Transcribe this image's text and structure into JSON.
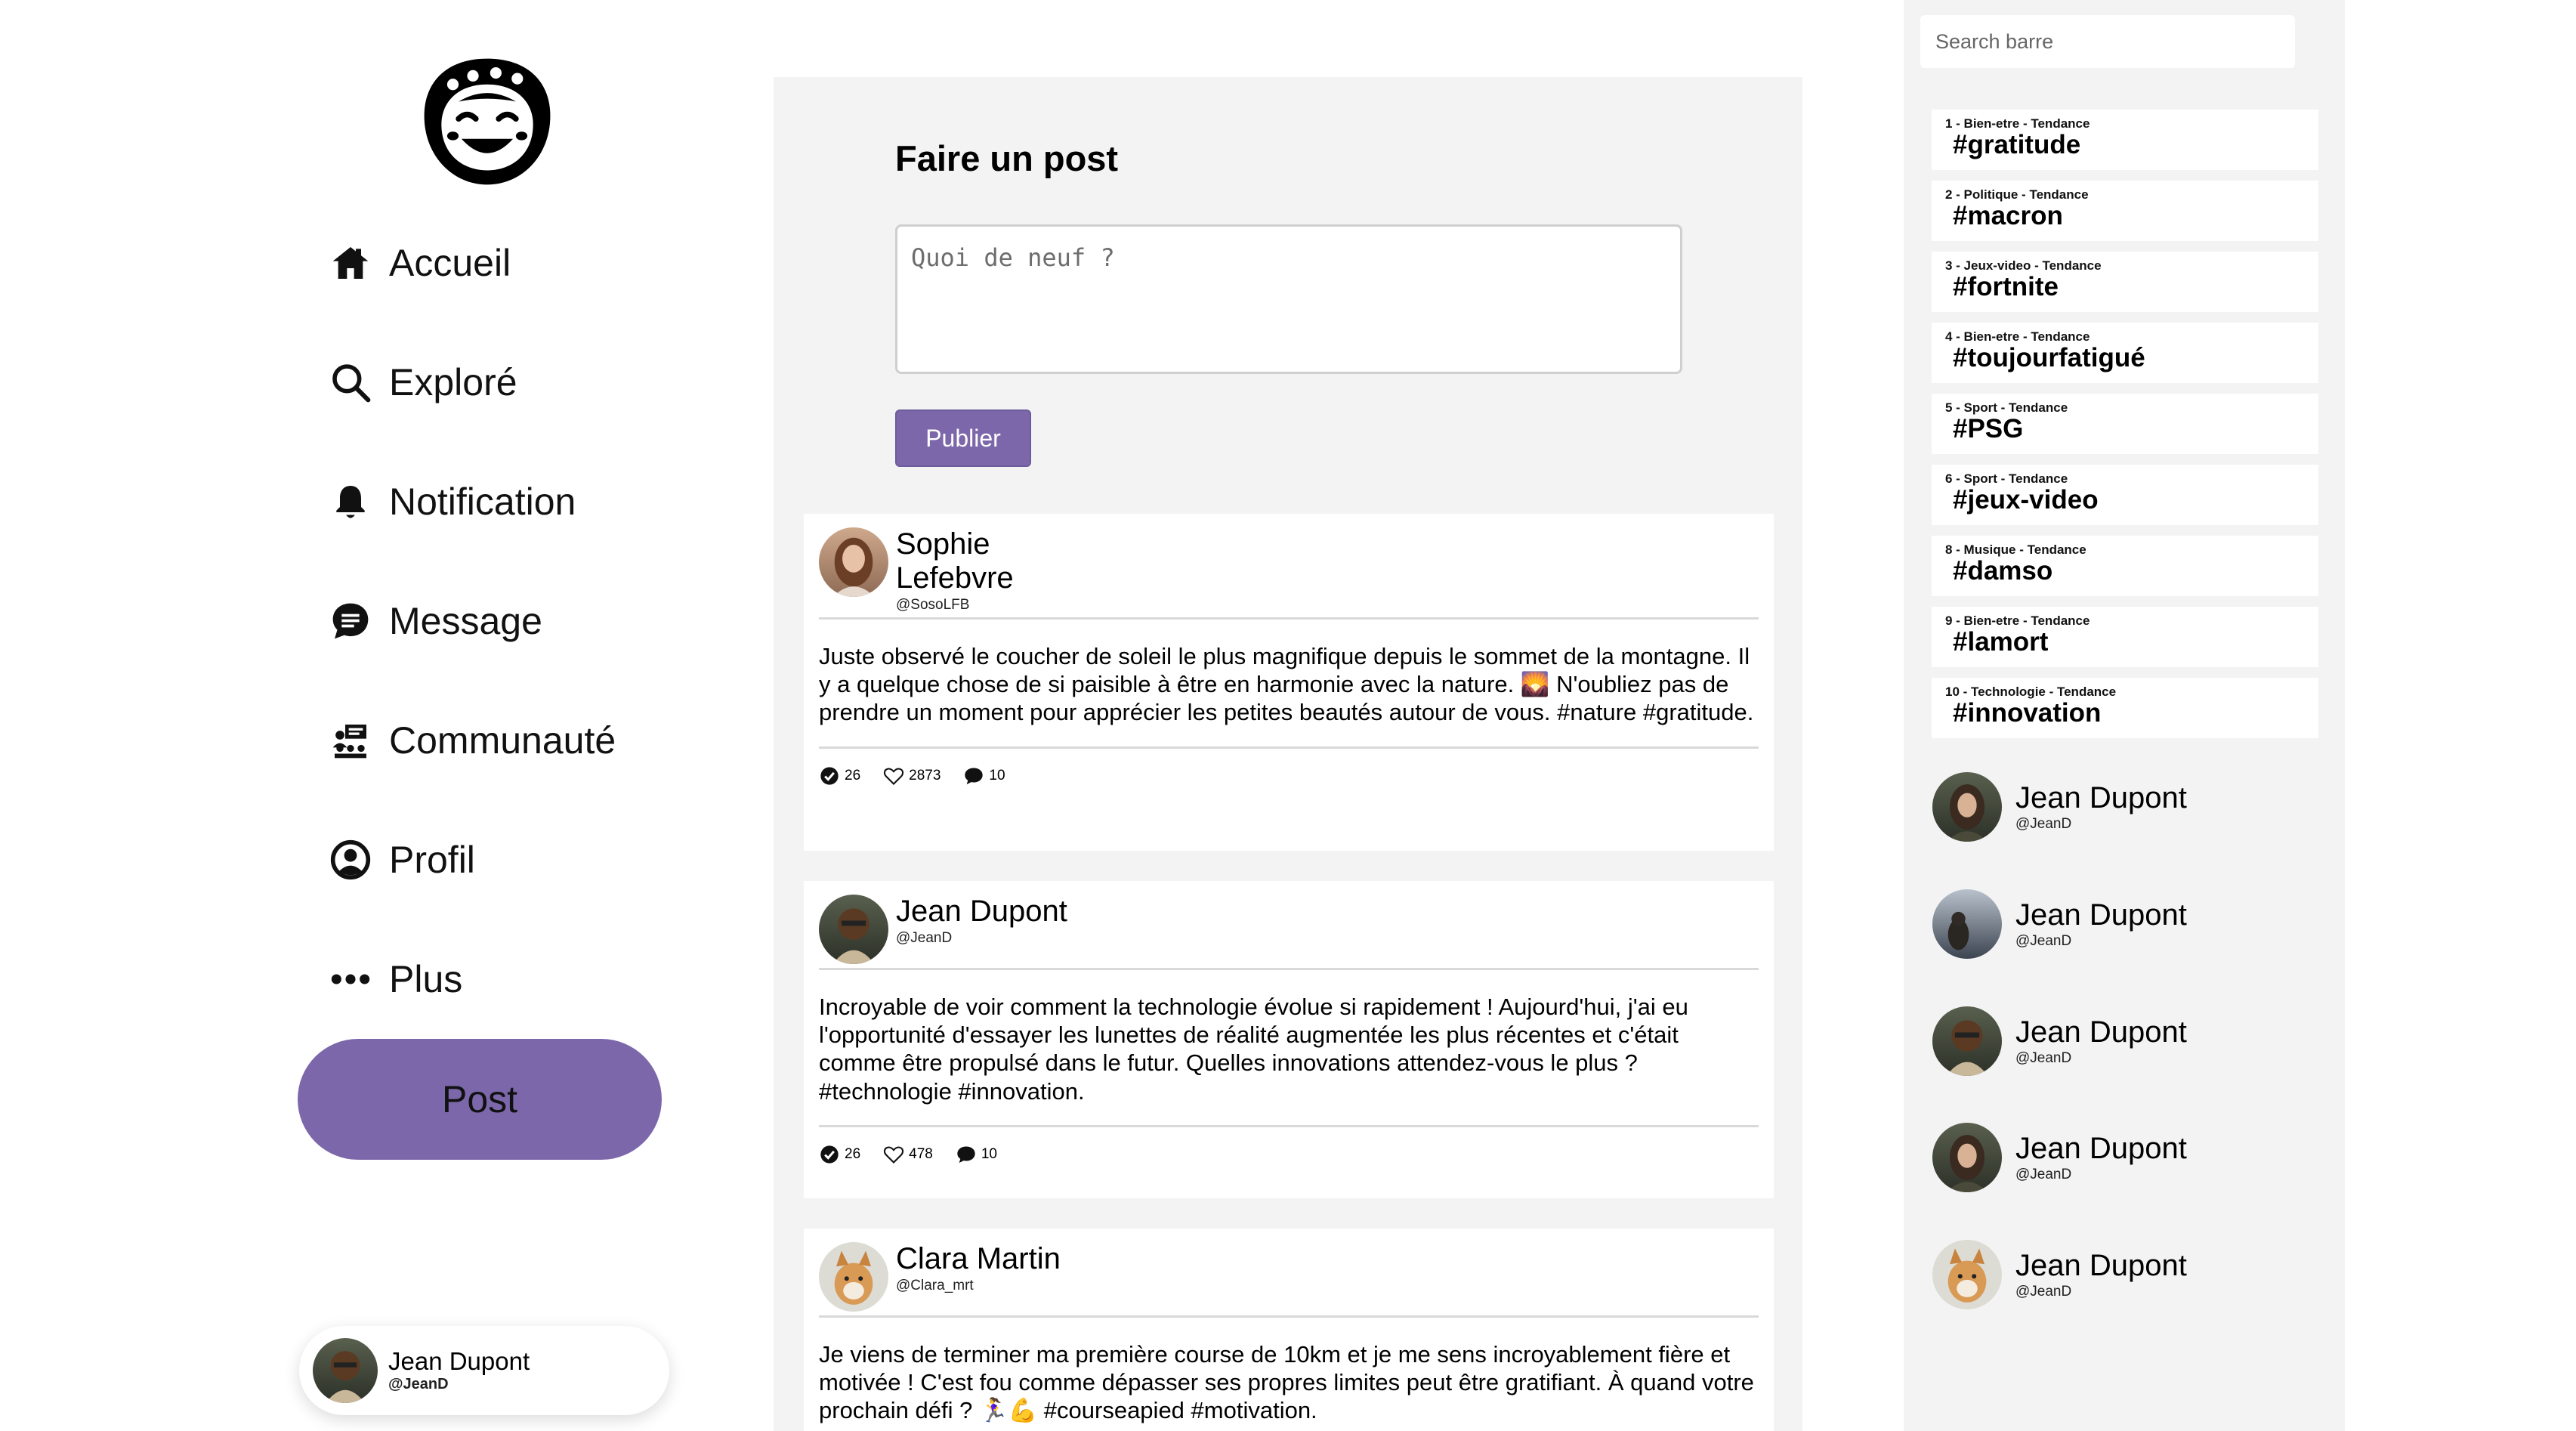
{
  "nav": {
    "items": [
      {
        "label": "Accueil",
        "icon": "home-icon"
      },
      {
        "label": "Exploré",
        "icon": "search-icon"
      },
      {
        "label": "Notification",
        "icon": "bell-icon"
      },
      {
        "label": "Message",
        "icon": "chat-icon"
      },
      {
        "label": "Communauté",
        "icon": "community-icon"
      },
      {
        "label": "Profil",
        "icon": "profile-icon"
      },
      {
        "label": "Plus",
        "icon": "more-icon"
      }
    ],
    "post_button": "Post",
    "accent_color": "#7b67aa"
  },
  "current_user": {
    "name": "Jean Dupont",
    "handle": "@JeanD"
  },
  "composer": {
    "title": "Faire un post",
    "placeholder": "Quoi de neuf ?",
    "publish_label": "Publier"
  },
  "feed": [
    {
      "author": "Sophie Lefebvre",
      "handle": "@SosoLFB",
      "text": "Juste observé le coucher de soleil le plus magnifique depuis le sommet de la montagne. Il y a quelque chose de si paisible à être en harmonie avec la nature. 🌄 N'oubliez pas de prendre un moment pour apprécier les petites beautés autour de vous. #nature #gratitude.",
      "reposts": "26",
      "likes": "2873",
      "comments": "10"
    },
    {
      "author": "Jean Dupont",
      "handle": "@JeanD",
      "text": "Incroyable de voir comment la technologie évolue si rapidement ! Aujourd'hui, j'ai eu l'opportunité d'essayer les lunettes de réalité augmentée les plus récentes et c'était comme être propulsé dans le futur. Quelles innovations attendez-vous le plus ? #technologie #innovation.",
      "reposts": "26",
      "likes": "478",
      "comments": "10"
    },
    {
      "author": "Clara Martin",
      "handle": "@Clara_mrt",
      "text": "Je viens de terminer ma première course de 10km et je me sens incroyablement fière et motivée ! C'est fou comme dépasser ses propres limites peut être gratifiant. À quand votre prochain défi ? 🏃‍♀️💪 #courseapied #motivation."
    }
  ],
  "sidebar_right": {
    "search_placeholder": "Search barre",
    "trends": [
      {
        "meta": "1 - Bien-etre - Tendance",
        "tag": "#gratitude"
      },
      {
        "meta": "2 - Politique - Tendance",
        "tag": "#macron"
      },
      {
        "meta": "3 - Jeux-video - Tendance",
        "tag": "#fortnite"
      },
      {
        "meta": "4 - Bien-etre - Tendance",
        "tag": "#toujourfatigué"
      },
      {
        "meta": "5 - Sport - Tendance",
        "tag": "#PSG"
      },
      {
        "meta": "6 - Sport - Tendance",
        "tag": "#jeux-video"
      },
      {
        "meta": "8 - Musique - Tendance",
        "tag": "#damso"
      },
      {
        "meta": "9 - Bien-etre - Tendance",
        "tag": "#lamort"
      },
      {
        "meta": "10 - Technologie - Tendance",
        "tag": "#innovation"
      }
    ],
    "suggestions": [
      {
        "name": "Jean Dupont",
        "handle": "@JeanD"
      },
      {
        "name": "Jean Dupont",
        "handle": "@JeanD"
      },
      {
        "name": "Jean Dupont",
        "handle": "@JeanD"
      },
      {
        "name": "Jean Dupont",
        "handle": "@JeanD"
      },
      {
        "name": "Jean Dupont",
        "handle": "@JeanD"
      }
    ]
  }
}
